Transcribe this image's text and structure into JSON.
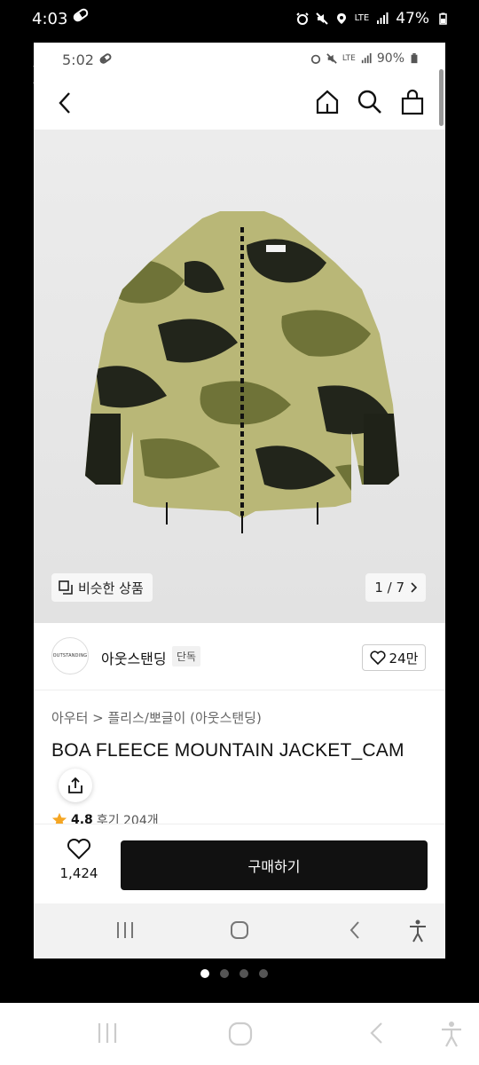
{
  "outer_status": {
    "time": "4:03",
    "network": "LTE",
    "battery": "47%"
  },
  "inner_status": {
    "time": "5:02",
    "network": "LTE",
    "battery": "90%"
  },
  "product": {
    "similar_label": "비슷한 상품",
    "page_indicator": "1 / 7",
    "brand_logo_text": "OUTSTANDING",
    "brand_name": "아웃스탠딩",
    "brand_tag": "단독",
    "brand_likes": "24만",
    "breadcrumb": "아우터 > 플리스/뽀글이 (아웃스탠딩)",
    "title": "BOA FLEECE MOUNTAIN JACKET_CAM",
    "rating": "4.8",
    "review_text": "후기 204개"
  },
  "buybar": {
    "wish_count": "1,424",
    "buy_label": "구매하기"
  },
  "carousel": {
    "total": 4,
    "active": 1
  },
  "colors": {
    "camo_light": "#b9b777",
    "camo_mid": "#6f7338",
    "camo_dark": "#22251b",
    "button_black": "#111111",
    "star": "#f5a623"
  }
}
